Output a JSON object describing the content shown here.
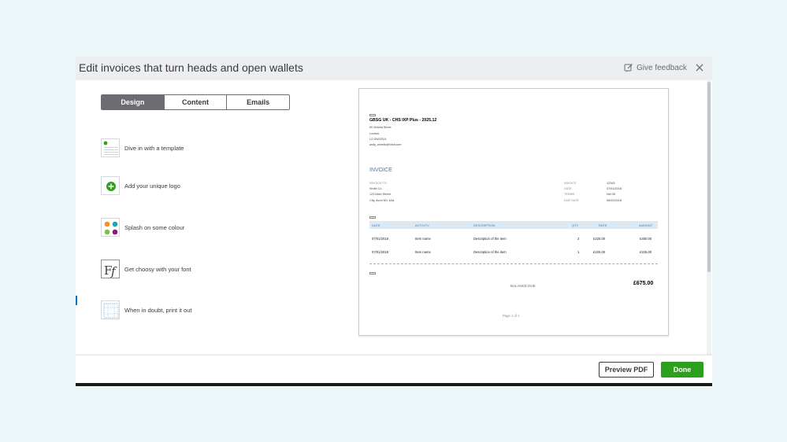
{
  "modal": {
    "title": "Edit invoices that turn heads and open wallets",
    "feedback_label": "Give feedback"
  },
  "tabs": [
    {
      "label": "Design",
      "active": true
    },
    {
      "label": "Content",
      "active": false
    },
    {
      "label": "Emails",
      "active": false
    }
  ],
  "features": [
    {
      "label": "Dive in with a template",
      "icon": "template-icon"
    },
    {
      "label": "Add your unique logo",
      "icon": "add-logo-icon"
    },
    {
      "label": "Splash on some colour",
      "icon": "colour-palette-icon"
    },
    {
      "label": "Get choosy with your font",
      "icon": "font-icon"
    },
    {
      "label": "When in doubt, print it out",
      "icon": "print-icon"
    }
  ],
  "invoice": {
    "company": "GBSG UK - CHS IXP Plus - 2025.12",
    "address_lines": [
      "80 Victoria Street",
      "London,",
      "LO SW1E5JL",
      "andy_annello@intuit.com"
    ],
    "title": "INVOICE",
    "invoice_to_label": "INVOICE TO",
    "customer_lines": [
      "Smith Co.",
      "123 Main Street",
      "City, Avon M1 1AA"
    ],
    "meta": [
      {
        "label": "INVOICE",
        "value": "12345"
      },
      {
        "label": "DATE",
        "value": "07/01/2018"
      },
      {
        "label": "TERMS",
        "value": "Net 30"
      },
      {
        "label": "DUE DATE",
        "value": "06/02/2018"
      }
    ],
    "columns": [
      "DATE",
      "ACTIVITY",
      "DESCRIPTION",
      "QTY",
      "RATE",
      "AMOUNT"
    ],
    "rows": [
      [
        "07/01/2018",
        "Item name",
        "Description of the item",
        "2",
        "£225.00",
        "£450.00"
      ],
      [
        "07/01/2018",
        "Item name",
        "Description of the item",
        "1",
        "£225.00",
        "£225.00"
      ]
    ],
    "balance_label": "BALANCE DUE",
    "balance_amount": "£675.00",
    "page_label": "Page 1 of 1"
  },
  "footer": {
    "preview_label": "Preview PDF",
    "done_label": "Done"
  },
  "colors": {
    "accent_blue": "#3b7db8",
    "done_green": "#2ca01c",
    "active_tab": "#6b6c72"
  }
}
